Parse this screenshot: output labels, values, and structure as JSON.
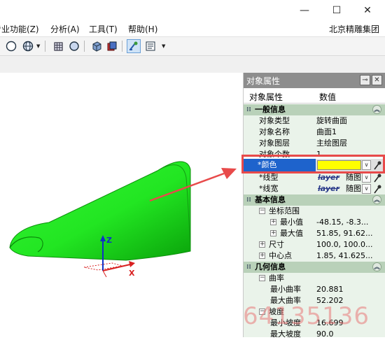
{
  "titlebar": {
    "minimize": "—",
    "maximize": "☐",
    "close": "✕"
  },
  "menu": {
    "items": [
      "专业功能(Z)",
      "分析(A)",
      "工具(T)",
      "帮助(H)"
    ],
    "company": "北京精雕集团"
  },
  "toolbar": {
    "icons": [
      "sphere-icon",
      "globe-icon",
      "grid-cube-icon",
      "circle-icon",
      "cube-icon",
      "layers-icon",
      "pick-icon",
      "properties-icon"
    ]
  },
  "viewport": {
    "axes": {
      "x": "X",
      "z": "Z"
    },
    "colors": {
      "surface": "#22e622",
      "surface_dark": "#0aa20a",
      "arrow": "#e84a4a",
      "axis_z": "#1030c8",
      "axis_x": "#d82020"
    }
  },
  "panel": {
    "title": "对象属性",
    "col_key": "对象属性",
    "col_value": "数值",
    "sections": {
      "general": "一般信息",
      "basic": "基本信息",
      "geometry": "几何信息"
    },
    "general": [
      {
        "key": "对象类型",
        "value": "旋转曲面"
      },
      {
        "key": "对象名称",
        "value": "曲面1"
      },
      {
        "key": "对象图层",
        "value": "主绘图层"
      },
      {
        "key": "对象个数",
        "value": "1"
      }
    ],
    "color": {
      "key": "*颜色",
      "swatch": "#ffff00"
    },
    "linetype": {
      "key": "*线型",
      "layer": "layer",
      "value": "随图"
    },
    "linewidth": {
      "key": "*线宽",
      "layer": "layer",
      "value": "随图"
    },
    "basic": {
      "coord_range": "坐标范围",
      "min_label": "最小值",
      "min_value": "-48.15, -8.3...",
      "max_label": "最大值",
      "max_value": "51.85, 91.62...",
      "size_label": "尺寸",
      "size_value": "100.0, 100.0...",
      "center_label": "中心点",
      "center_value": "1.85, 41.625..."
    },
    "geometry": {
      "curvature": "曲率",
      "min_curv_label": "最小曲率",
      "min_curv_value": "20.881",
      "max_curv_label": "最大曲率",
      "max_curv_value": "52.202",
      "slope": "坡度",
      "min_slope_label": "最小坡度",
      "min_slope_value": "16.699",
      "max_slope_label": "最大坡度",
      "max_slope_value": "90.0"
    }
  },
  "watermark": "64135136"
}
